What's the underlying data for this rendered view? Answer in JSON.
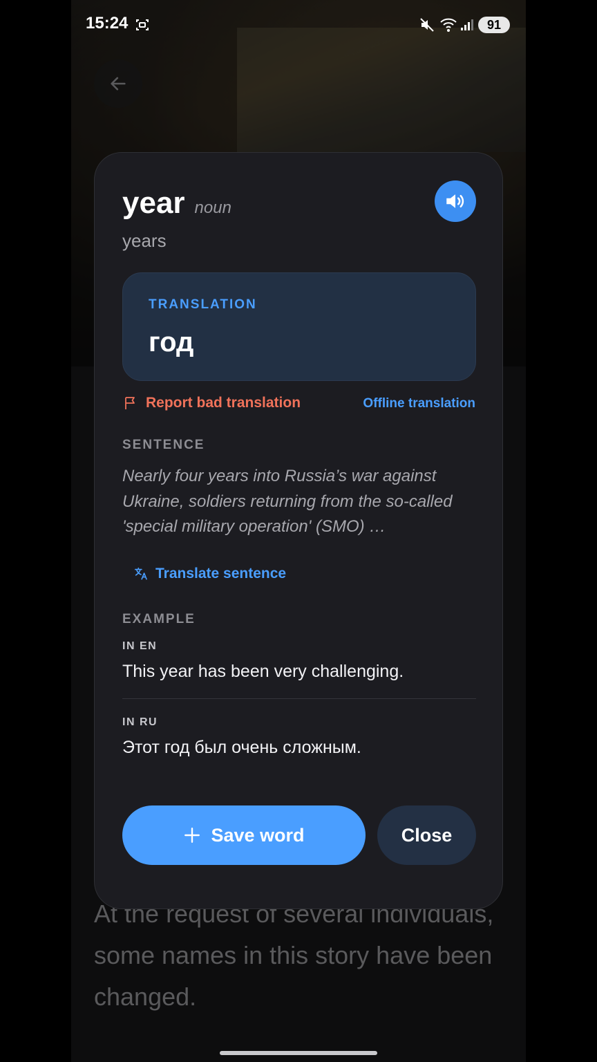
{
  "status_bar": {
    "time": "15:24",
    "battery": "91"
  },
  "article": {
    "body_text": "At the request of several individuals, some names in this story have been changed."
  },
  "card": {
    "word": "year",
    "part_of_speech": "noun",
    "plural": "years",
    "translation_label": "TRANSLATION",
    "translation": "год",
    "report_label": "Report bad translation",
    "offline_label": "Offline translation",
    "sentence_label": "SENTENCE",
    "sentence": "Nearly four years into Russia’s war against Ukraine, soldiers returning from the so-called 'special military operation' (SMO) …",
    "translate_sentence_label": "Translate sentence",
    "example_label": "EXAMPLE",
    "example_en_label": "IN EN",
    "example_en": "This year has been very challenging.",
    "example_ru_label": "IN RU",
    "example_ru": "Этот год был очень сложным.",
    "save_label": "Save word",
    "close_label": "Close"
  },
  "colors": {
    "accent": "#4a9eff",
    "report": "#f0725a",
    "sheet_bg": "#1c1c21",
    "translation_card_bg": "#223044"
  },
  "icons": [
    "back-arrow-icon",
    "speaker-icon",
    "flag-icon",
    "translate-icon",
    "plus-icon",
    "mute-icon",
    "wifi-icon",
    "signal-icon",
    "screenshot-icon"
  ]
}
